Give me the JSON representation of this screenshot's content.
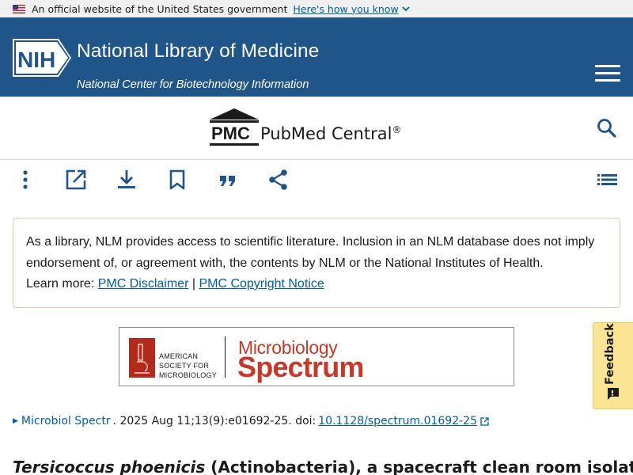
{
  "gov_banner": {
    "text": "An official website of the United States government",
    "link": "Here's how you know"
  },
  "nih": {
    "logo_text": "NIH",
    "title": "National Library of Medicine",
    "subtitle": "National Center for Biotechnology Information"
  },
  "pmc": {
    "logo_text": "PMC",
    "name": "PubMed Central",
    "reg": "®"
  },
  "toolbar": {
    "icons": [
      "more-vertical-icon",
      "open-external-icon",
      "download-icon",
      "bookmark-icon",
      "cite-quote-icon",
      "share-icon",
      "table-of-contents-icon"
    ]
  },
  "disclaimer": {
    "text": "As a library, NLM provides access to scientific literature. Inclusion in an NLM database does not imply endorsement of, or agreement with, the contents by NLM or the National Institutes of Health.",
    "learn_more": "Learn more:",
    "link1": "PMC Disclaimer",
    "separator": "|",
    "link2": "PMC Copyright Notice"
  },
  "journal_banner": {
    "publisher_line1": "AMERICAN",
    "publisher_line2": "SOCIETY FOR",
    "publisher_line3": "MICROBIOLOGY",
    "line1": "Microbiology",
    "line2": "Spectrum"
  },
  "citation": {
    "journal": "Microbiol Spectr",
    "details": ". 2025 Aug 11;13(9):e01692-25. doi: ",
    "doi": "10.1128/spectrum.01692-25"
  },
  "article": {
    "title_italic": "Tersicoccus phoenicis",
    "title_rest": " (Actinobacteria), a spacecraft clean room isolate,"
  },
  "feedback": {
    "label": "Feedback"
  },
  "colors": {
    "nih_blue": "#20558a",
    "link_blue": "#005ea2",
    "asm_red": "#b22a1e",
    "feedback_yellow": "#fbe493"
  }
}
